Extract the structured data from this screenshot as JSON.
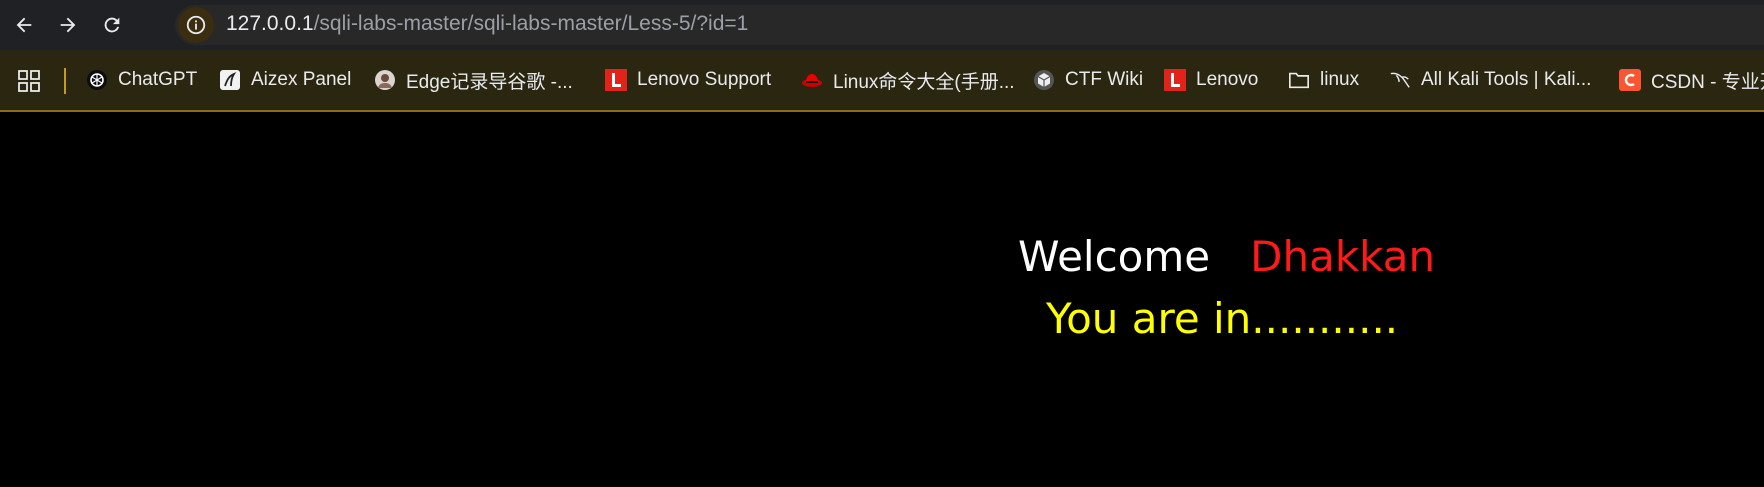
{
  "address_bar": {
    "host": "127.0.0.1",
    "path": "/sqli-labs-master/sqli-labs-master/Less-5/?id=1"
  },
  "bookmarks": [
    {
      "label": "ChatGPT",
      "icon": "chatgpt-icon"
    },
    {
      "label": "Aizex Panel",
      "icon": "aizex-icon"
    },
    {
      "label": "Edge记录导谷歌 -...",
      "icon": "avatar-icon"
    },
    {
      "label": "Lenovo Support",
      "icon": "lenovo-icon"
    },
    {
      "label": "Linux命令大全(手册...",
      "icon": "redhat-icon"
    },
    {
      "label": "CTF Wiki",
      "icon": "ctf-icon"
    },
    {
      "label": "Lenovo",
      "icon": "lenovo-icon"
    },
    {
      "label": "linux",
      "icon": "folder-icon"
    },
    {
      "label": "All Kali Tools | Kali...",
      "icon": "kali-icon"
    },
    {
      "label": "CSDN - 专业开",
      "icon": "csdn-icon"
    }
  ],
  "page": {
    "welcome_label": "Welcome",
    "name": "Dhakkan",
    "status": "You are in..........."
  },
  "colors": {
    "toolbar": "#202124",
    "bookmark_bar": "#2a2610",
    "page_background": "#000000",
    "welcome": "#ffffff",
    "name": "#ff1a1a",
    "status": "#ffff00",
    "lenovo": "#e2231a",
    "csdn": "#fc5531"
  }
}
